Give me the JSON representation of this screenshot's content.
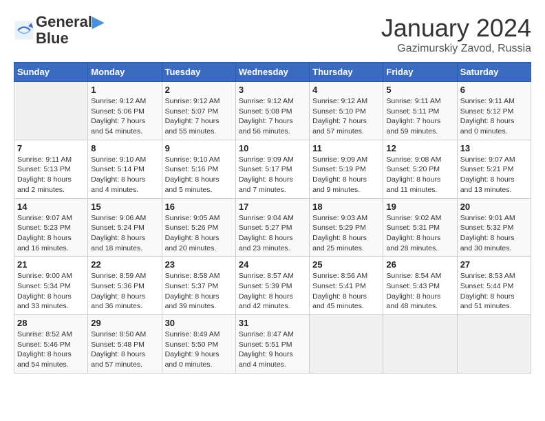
{
  "logo": {
    "line1": "General",
    "line2": "Blue"
  },
  "title": "January 2024",
  "subtitle": "Gazimurskiy Zavod, Russia",
  "headers": [
    "Sunday",
    "Monday",
    "Tuesday",
    "Wednesday",
    "Thursday",
    "Friday",
    "Saturday"
  ],
  "weeks": [
    [
      {
        "day": "",
        "info": ""
      },
      {
        "day": "1",
        "info": "Sunrise: 9:12 AM\nSunset: 5:06 PM\nDaylight: 7 hours\nand 54 minutes."
      },
      {
        "day": "2",
        "info": "Sunrise: 9:12 AM\nSunset: 5:07 PM\nDaylight: 7 hours\nand 55 minutes."
      },
      {
        "day": "3",
        "info": "Sunrise: 9:12 AM\nSunset: 5:08 PM\nDaylight: 7 hours\nand 56 minutes."
      },
      {
        "day": "4",
        "info": "Sunrise: 9:12 AM\nSunset: 5:10 PM\nDaylight: 7 hours\nand 57 minutes."
      },
      {
        "day": "5",
        "info": "Sunrise: 9:11 AM\nSunset: 5:11 PM\nDaylight: 7 hours\nand 59 minutes."
      },
      {
        "day": "6",
        "info": "Sunrise: 9:11 AM\nSunset: 5:12 PM\nDaylight: 8 hours\nand 0 minutes."
      }
    ],
    [
      {
        "day": "7",
        "info": "Sunrise: 9:11 AM\nSunset: 5:13 PM\nDaylight: 8 hours\nand 2 minutes."
      },
      {
        "day": "8",
        "info": "Sunrise: 9:10 AM\nSunset: 5:14 PM\nDaylight: 8 hours\nand 4 minutes."
      },
      {
        "day": "9",
        "info": "Sunrise: 9:10 AM\nSunset: 5:16 PM\nDaylight: 8 hours\nand 5 minutes."
      },
      {
        "day": "10",
        "info": "Sunrise: 9:09 AM\nSunset: 5:17 PM\nDaylight: 8 hours\nand 7 minutes."
      },
      {
        "day": "11",
        "info": "Sunrise: 9:09 AM\nSunset: 5:19 PM\nDaylight: 8 hours\nand 9 minutes."
      },
      {
        "day": "12",
        "info": "Sunrise: 9:08 AM\nSunset: 5:20 PM\nDaylight: 8 hours\nand 11 minutes."
      },
      {
        "day": "13",
        "info": "Sunrise: 9:07 AM\nSunset: 5:21 PM\nDaylight: 8 hours\nand 13 minutes."
      }
    ],
    [
      {
        "day": "14",
        "info": "Sunrise: 9:07 AM\nSunset: 5:23 PM\nDaylight: 8 hours\nand 16 minutes."
      },
      {
        "day": "15",
        "info": "Sunrise: 9:06 AM\nSunset: 5:24 PM\nDaylight: 8 hours\nand 18 minutes."
      },
      {
        "day": "16",
        "info": "Sunrise: 9:05 AM\nSunset: 5:26 PM\nDaylight: 8 hours\nand 20 minutes."
      },
      {
        "day": "17",
        "info": "Sunrise: 9:04 AM\nSunset: 5:27 PM\nDaylight: 8 hours\nand 23 minutes."
      },
      {
        "day": "18",
        "info": "Sunrise: 9:03 AM\nSunset: 5:29 PM\nDaylight: 8 hours\nand 25 minutes."
      },
      {
        "day": "19",
        "info": "Sunrise: 9:02 AM\nSunset: 5:31 PM\nDaylight: 8 hours\nand 28 minutes."
      },
      {
        "day": "20",
        "info": "Sunrise: 9:01 AM\nSunset: 5:32 PM\nDaylight: 8 hours\nand 30 minutes."
      }
    ],
    [
      {
        "day": "21",
        "info": "Sunrise: 9:00 AM\nSunset: 5:34 PM\nDaylight: 8 hours\nand 33 minutes."
      },
      {
        "day": "22",
        "info": "Sunrise: 8:59 AM\nSunset: 5:36 PM\nDaylight: 8 hours\nand 36 minutes."
      },
      {
        "day": "23",
        "info": "Sunrise: 8:58 AM\nSunset: 5:37 PM\nDaylight: 8 hours\nand 39 minutes."
      },
      {
        "day": "24",
        "info": "Sunrise: 8:57 AM\nSunset: 5:39 PM\nDaylight: 8 hours\nand 42 minutes."
      },
      {
        "day": "25",
        "info": "Sunrise: 8:56 AM\nSunset: 5:41 PM\nDaylight: 8 hours\nand 45 minutes."
      },
      {
        "day": "26",
        "info": "Sunrise: 8:54 AM\nSunset: 5:43 PM\nDaylight: 8 hours\nand 48 minutes."
      },
      {
        "day": "27",
        "info": "Sunrise: 8:53 AM\nSunset: 5:44 PM\nDaylight: 8 hours\nand 51 minutes."
      }
    ],
    [
      {
        "day": "28",
        "info": "Sunrise: 8:52 AM\nSunset: 5:46 PM\nDaylight: 8 hours\nand 54 minutes."
      },
      {
        "day": "29",
        "info": "Sunrise: 8:50 AM\nSunset: 5:48 PM\nDaylight: 8 hours\nand 57 minutes."
      },
      {
        "day": "30",
        "info": "Sunrise: 8:49 AM\nSunset: 5:50 PM\nDaylight: 9 hours\nand 0 minutes."
      },
      {
        "day": "31",
        "info": "Sunrise: 8:47 AM\nSunset: 5:51 PM\nDaylight: 9 hours\nand 4 minutes."
      },
      {
        "day": "",
        "info": ""
      },
      {
        "day": "",
        "info": ""
      },
      {
        "day": "",
        "info": ""
      }
    ]
  ]
}
